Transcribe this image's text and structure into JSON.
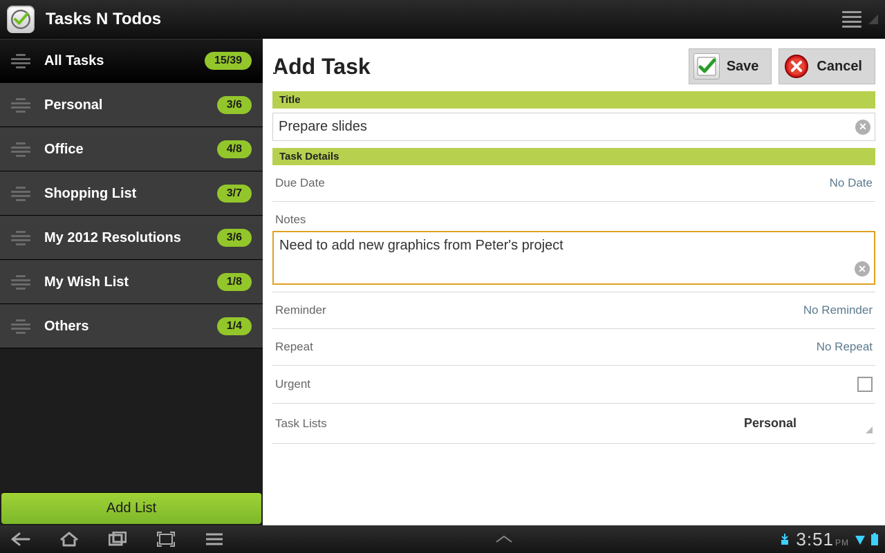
{
  "app": {
    "title": "Tasks N Todos"
  },
  "sidebar": {
    "items": [
      {
        "label": "All Tasks",
        "count": "15/39",
        "selected": true
      },
      {
        "label": "Personal",
        "count": "3/6"
      },
      {
        "label": "Office",
        "count": "4/8"
      },
      {
        "label": "Shopping List",
        "count": "3/7"
      },
      {
        "label": "My 2012 Resolutions",
        "count": "3/6"
      },
      {
        "label": "My Wish List",
        "count": "1/8"
      },
      {
        "label": "Others",
        "count": "1/4"
      }
    ],
    "add_list_label": "Add List"
  },
  "form": {
    "heading": "Add Task",
    "save_label": "Save",
    "cancel_label": "Cancel",
    "section_title": "Title",
    "title_value": "Prepare slides",
    "section_details": "Task Details",
    "due_date_label": "Due Date",
    "due_date_value": "No Date",
    "notes_label": "Notes",
    "notes_value": "Need to add new graphics from Peter's project",
    "reminder_label": "Reminder",
    "reminder_value": "No Reminder",
    "repeat_label": "Repeat",
    "repeat_value": "No Repeat",
    "urgent_label": "Urgent",
    "tasklists_label": "Task Lists",
    "tasklists_value": "Personal"
  },
  "statusbar": {
    "time": "3:51",
    "ampm": "PM"
  }
}
